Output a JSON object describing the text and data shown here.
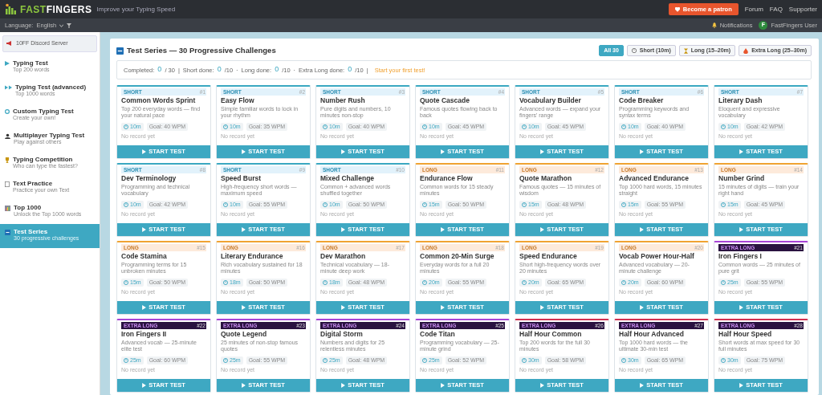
{
  "brand": {
    "name_a": "FAST",
    "name_b": "FINGERS",
    "tagline": "Improve your Typing Speed"
  },
  "top_nav": {
    "patron_button": "Become a patron",
    "links": [
      "Forum",
      "FAQ",
      "Supporter"
    ]
  },
  "sub_bar": {
    "language_label": "Language:",
    "language_value": "English",
    "notifications": "Notifications",
    "user": {
      "initial": "F",
      "name": "FastFingers User"
    }
  },
  "sidebar": {
    "discord": "10FF Discord Server",
    "items": [
      {
        "title": "Typing Test",
        "subtitle": "Top 200 words",
        "selected": false
      },
      {
        "title": "Typing Test (advanced)",
        "subtitle": "Top 1000 words",
        "selected": false
      },
      {
        "title": "Custom Typing Test",
        "subtitle": "Create your own!",
        "selected": false
      },
      {
        "title": "Multiplayer Typing Test",
        "subtitle": "Play against others",
        "selected": false
      },
      {
        "title": "Typing Competition",
        "subtitle": "Who can type the fastest?",
        "selected": false
      },
      {
        "title": "Text Practice",
        "subtitle": "Practice your own Text",
        "selected": false
      },
      {
        "title": "Top 1000",
        "subtitle": "Unlock the Top 1000 words",
        "selected": false
      },
      {
        "title": "Test Series",
        "subtitle": "30 progressive challenges",
        "selected": true
      }
    ]
  },
  "main": {
    "title": "Test Series — 30 Progressive Challenges",
    "filters": [
      {
        "label": "All 30",
        "selected": true
      },
      {
        "label": "Short (10m)",
        "selected": false
      },
      {
        "label": "Long (15–20m)",
        "selected": false
      },
      {
        "label": "Extra Long (25–30m)",
        "selected": false
      }
    ],
    "stats": [
      {
        "label": "Completed:",
        "value": "0",
        "total": "/ 30",
        "sep": "|"
      },
      {
        "label": "Short done:",
        "value": "0",
        "total": "/10",
        "sep": "·"
      },
      {
        "label": "Long done:",
        "value": "0",
        "total": "/10",
        "sep": "·"
      },
      {
        "label": "Extra Long done:",
        "value": "0",
        "total": "/10",
        "sep": "|"
      }
    ],
    "cta": "Start your first test!",
    "cards": [
      {
        "number": "#1",
        "kind": "short",
        "tier": "SHORT",
        "color": "#3aa8c1",
        "title": "Common Words Sprint",
        "description": "Top 200 everyday words — find your natural pace",
        "time": "10m",
        "goal": "Goal: 40 WPM",
        "record": "No record yet",
        "button": "START TEST"
      },
      {
        "number": "#2",
        "kind": "short",
        "tier": "SHORT",
        "color": "#3aa8c1",
        "title": "Easy Flow",
        "description": "Simple familiar words to lock in your rhythm",
        "time": "10m",
        "goal": "Goal: 35 WPM",
        "record": "No record yet",
        "button": "START TEST"
      },
      {
        "number": "#3",
        "kind": "short",
        "tier": "SHORT",
        "color": "#3aa8c1",
        "title": "Number Rush",
        "description": "Pure digits and numbers, 10 minutes non-stop",
        "time": "10m",
        "goal": "Goal: 40 WPM",
        "record": "No record yet",
        "button": "START TEST"
      },
      {
        "number": "#4",
        "kind": "short",
        "tier": "SHORT",
        "color": "#3aa8c1",
        "title": "Quote Cascade",
        "description": "Famous quotes flowing back to back",
        "time": "10m",
        "goal": "Goal: 45 WPM",
        "record": "No record yet",
        "button": "START TEST"
      },
      {
        "number": "#5",
        "kind": "short",
        "tier": "SHORT",
        "color": "#3aa8c1",
        "title": "Vocabulary Builder",
        "description": "Advanced words — expand your fingers' range",
        "time": "10m",
        "goal": "Goal: 45 WPM",
        "record": "No record yet",
        "button": "START TEST"
      },
      {
        "number": "#6",
        "kind": "short",
        "tier": "SHORT",
        "color": "#3aa8c1",
        "title": "Code Breaker",
        "description": "Programming keywords and syntax terms",
        "time": "10m",
        "goal": "Goal: 40 WPM",
        "record": "No record yet",
        "button": "START TEST"
      },
      {
        "number": "#7",
        "kind": "short",
        "tier": "SHORT",
        "color": "#3aa8c1",
        "title": "Literary Dash",
        "description": "Eloquent and expressive vocabulary",
        "time": "10m",
        "goal": "Goal: 42 WPM",
        "record": "No record yet",
        "button": "START TEST"
      },
      {
        "number": "#8",
        "kind": "short",
        "tier": "SHORT",
        "color": "#3aa8c1",
        "title": "Dev Terminology",
        "description": "Programming and technical vocabulary",
        "time": "10m",
        "goal": "Goal: 42 WPM",
        "record": "No record yet",
        "button": "START TEST"
      },
      {
        "number": "#9",
        "kind": "short",
        "tier": "SHORT",
        "color": "#3aa8c1",
        "title": "Speed Burst",
        "description": "High-frequency short words — maximum speed",
        "time": "10m",
        "goal": "Goal: 55 WPM",
        "record": "No record yet",
        "button": "START TEST"
      },
      {
        "number": "#10",
        "kind": "short",
        "tier": "SHORT",
        "color": "#3aa8c1",
        "title": "Mixed Challenge",
        "description": "Common + advanced words shuffled together",
        "time": "10m",
        "goal": "Goal: 50 WPM",
        "record": "No record yet",
        "button": "START TEST"
      },
      {
        "number": "#11",
        "kind": "long",
        "tier": "LONG",
        "color": "#f0a332",
        "title": "Endurance Flow",
        "description": "Common words for 15 steady minutes",
        "time": "15m",
        "goal": "Goal: 50 WPM",
        "record": "No record yet",
        "button": "START TEST"
      },
      {
        "number": "#12",
        "kind": "long",
        "tier": "LONG",
        "color": "#f0a332",
        "title": "Quote Marathon",
        "description": "Famous quotes — 15 minutes of wisdom",
        "time": "15m",
        "goal": "Goal: 48 WPM",
        "record": "No record yet",
        "button": "START TEST"
      },
      {
        "number": "#13",
        "kind": "long",
        "tier": "LONG",
        "color": "#f0a332",
        "title": "Advanced Endurance",
        "description": "Top 1000 hard words, 15 minutes straight",
        "time": "15m",
        "goal": "Goal: 55 WPM",
        "record": "No record yet",
        "button": "START TEST"
      },
      {
        "number": "#14",
        "kind": "long",
        "tier": "LONG",
        "color": "#f0a332",
        "title": "Number Grind",
        "description": "15 minutes of digits — train your right hand",
        "time": "15m",
        "goal": "Goal: 45 WPM",
        "record": "No record yet",
        "button": "START TEST"
      },
      {
        "number": "#15",
        "kind": "long",
        "tier": "LONG",
        "color": "#f0a332",
        "title": "Code Stamina",
        "description": "Programming terms for 15 unbroken minutes",
        "time": "15m",
        "goal": "Goal: 50 WPM",
        "record": "No record yet",
        "button": "START TEST"
      },
      {
        "number": "#16",
        "kind": "long",
        "tier": "LONG",
        "color": "#f0a332",
        "title": "Literary Endurance",
        "description": "Rich vocabulary sustained for 18 minutes",
        "time": "18m",
        "goal": "Goal: 50 WPM",
        "record": "No record yet",
        "button": "START TEST"
      },
      {
        "number": "#17",
        "kind": "long",
        "tier": "LONG",
        "color": "#f0a332",
        "title": "Dev Marathon",
        "description": "Technical vocabulary — 18-minute deep work",
        "time": "18m",
        "goal": "Goal: 48 WPM",
        "record": "No record yet",
        "button": "START TEST"
      },
      {
        "number": "#18",
        "kind": "long",
        "tier": "LONG",
        "color": "#f0a332",
        "title": "Common 20-Min Surge",
        "description": "Everyday words for a full 20 minutes",
        "time": "20m",
        "goal": "Goal: 55 WPM",
        "record": "No record yet",
        "button": "START TEST"
      },
      {
        "number": "#19",
        "kind": "long",
        "tier": "LONG",
        "color": "#f0a332",
        "title": "Speed Endurance",
        "description": "Short high-frequency words over 20 minutes",
        "time": "20m",
        "goal": "Goal: 65 WPM",
        "record": "No record yet",
        "button": "START TEST"
      },
      {
        "number": "#20",
        "kind": "long",
        "tier": "LONG",
        "color": "#f0a332",
        "title": "Vocab Power Hour-Half",
        "description": "Advanced vocabulary — 20-minute challenge",
        "time": "20m",
        "goal": "Goal: 60 WPM",
        "record": "No record yet",
        "button": "START TEST"
      },
      {
        "number": "#21",
        "kind": "extra",
        "tier": "EXTRA LONG",
        "color": "#a846d6",
        "title": "Iron Fingers I",
        "description": "Common words — 25 minutes of pure grit",
        "time": "25m",
        "goal": "Goal: 55 WPM",
        "record": "No record yet",
        "button": "START TEST"
      },
      {
        "number": "#22",
        "kind": "extra",
        "tier": "EXTRA LONG",
        "color": "#a846d6",
        "title": "Iron Fingers II",
        "description": "Advanced vocab — 25-minute elite test",
        "time": "25m",
        "goal": "Goal: 60 WPM",
        "record": "No record yet",
        "button": "START TEST"
      },
      {
        "number": "#23",
        "kind": "extra",
        "tier": "EXTRA LONG",
        "color": "#a846d6",
        "title": "Quote Legend",
        "description": "25 minutes of non-stop famous quotes",
        "time": "25m",
        "goal": "Goal: 55 WPM",
        "record": "No record yet",
        "button": "START TEST"
      },
      {
        "number": "#24",
        "kind": "extra",
        "tier": "EXTRA LONG",
        "color": "#a846d6",
        "title": "Digital Storm",
        "description": "Numbers and digits for 25 relentless minutes",
        "time": "25m",
        "goal": "Goal: 48 WPM",
        "record": "No record yet",
        "button": "START TEST"
      },
      {
        "number": "#25",
        "kind": "extra",
        "tier": "EXTRA LONG",
        "color": "#a846d6",
        "title": "Code Titan",
        "description": "Programming vocabulary — 25-minute grind",
        "time": "25m",
        "goal": "Goal: 52 WPM",
        "record": "No record yet",
        "button": "START TEST"
      },
      {
        "number": "#26",
        "kind": "extra",
        "tier": "EXTRA LONG",
        "color": "#d2304f",
        "title": "Half Hour Common",
        "description": "Top 200 words for the full 30 minutes",
        "time": "30m",
        "goal": "Goal: 58 WPM",
        "record": "No record yet",
        "button": "START TEST"
      },
      {
        "number": "#27",
        "kind": "extra",
        "tier": "EXTRA LONG",
        "color": "#d2304f",
        "title": "Half Hour Advanced",
        "description": "Top 1000 hard words — the ultimate 30-min test",
        "time": "30m",
        "goal": "Goal: 65 WPM",
        "record": "No record yet",
        "button": "START TEST"
      },
      {
        "number": "#28",
        "kind": "extra",
        "tier": "EXTRA LONG",
        "color": "#d2304f",
        "title": "Half Hour Speed",
        "description": "Short words at max speed for 30 full minutes",
        "time": "30m",
        "goal": "Goal: 75 WPM",
        "record": "No record yet",
        "button": "START TEST"
      }
    ]
  }
}
